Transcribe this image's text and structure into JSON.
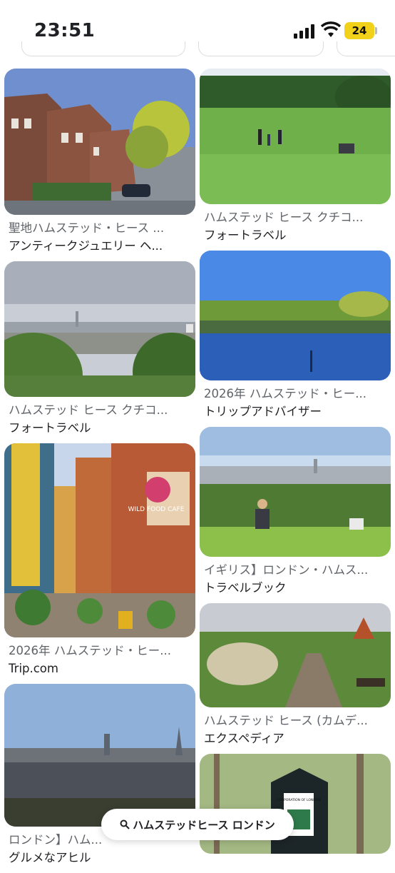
{
  "status_bar": {
    "time": "23:51",
    "battery": "24"
  },
  "results": {
    "left": [
      {
        "title": "聖地ハムステッド・ヒース ...",
        "source": "アンティークジュエリー ヘ..."
      },
      {
        "title": "ハムステッド ヒース クチコ...",
        "source": "フォートラベル"
      },
      {
        "title": "2026年 ハムステッド・ヒー...",
        "source": "Trip.com"
      },
      {
        "title": "ロンドン】ハム...",
        "source": "グルメなアヒル"
      }
    ],
    "right": [
      {
        "title": "ハムステッド ヒース クチコ...",
        "source": "フォートラベル"
      },
      {
        "title": "2026年 ハムステッド・ヒー...",
        "source": "トリップアドバイザー"
      },
      {
        "title": "イギリス】ロンドン・ハムス...",
        "source": "トラベルブック"
      },
      {
        "title": "ハムステッド ヒース (カムデ...",
        "source": "エクスペディア"
      }
    ]
  },
  "image_text": {
    "cafe_sign": "WILD FOOD CAFE",
    "park_sign": "CORPORATION OF LONDON"
  },
  "search_query": "ハムステッドヒース ロンドン"
}
